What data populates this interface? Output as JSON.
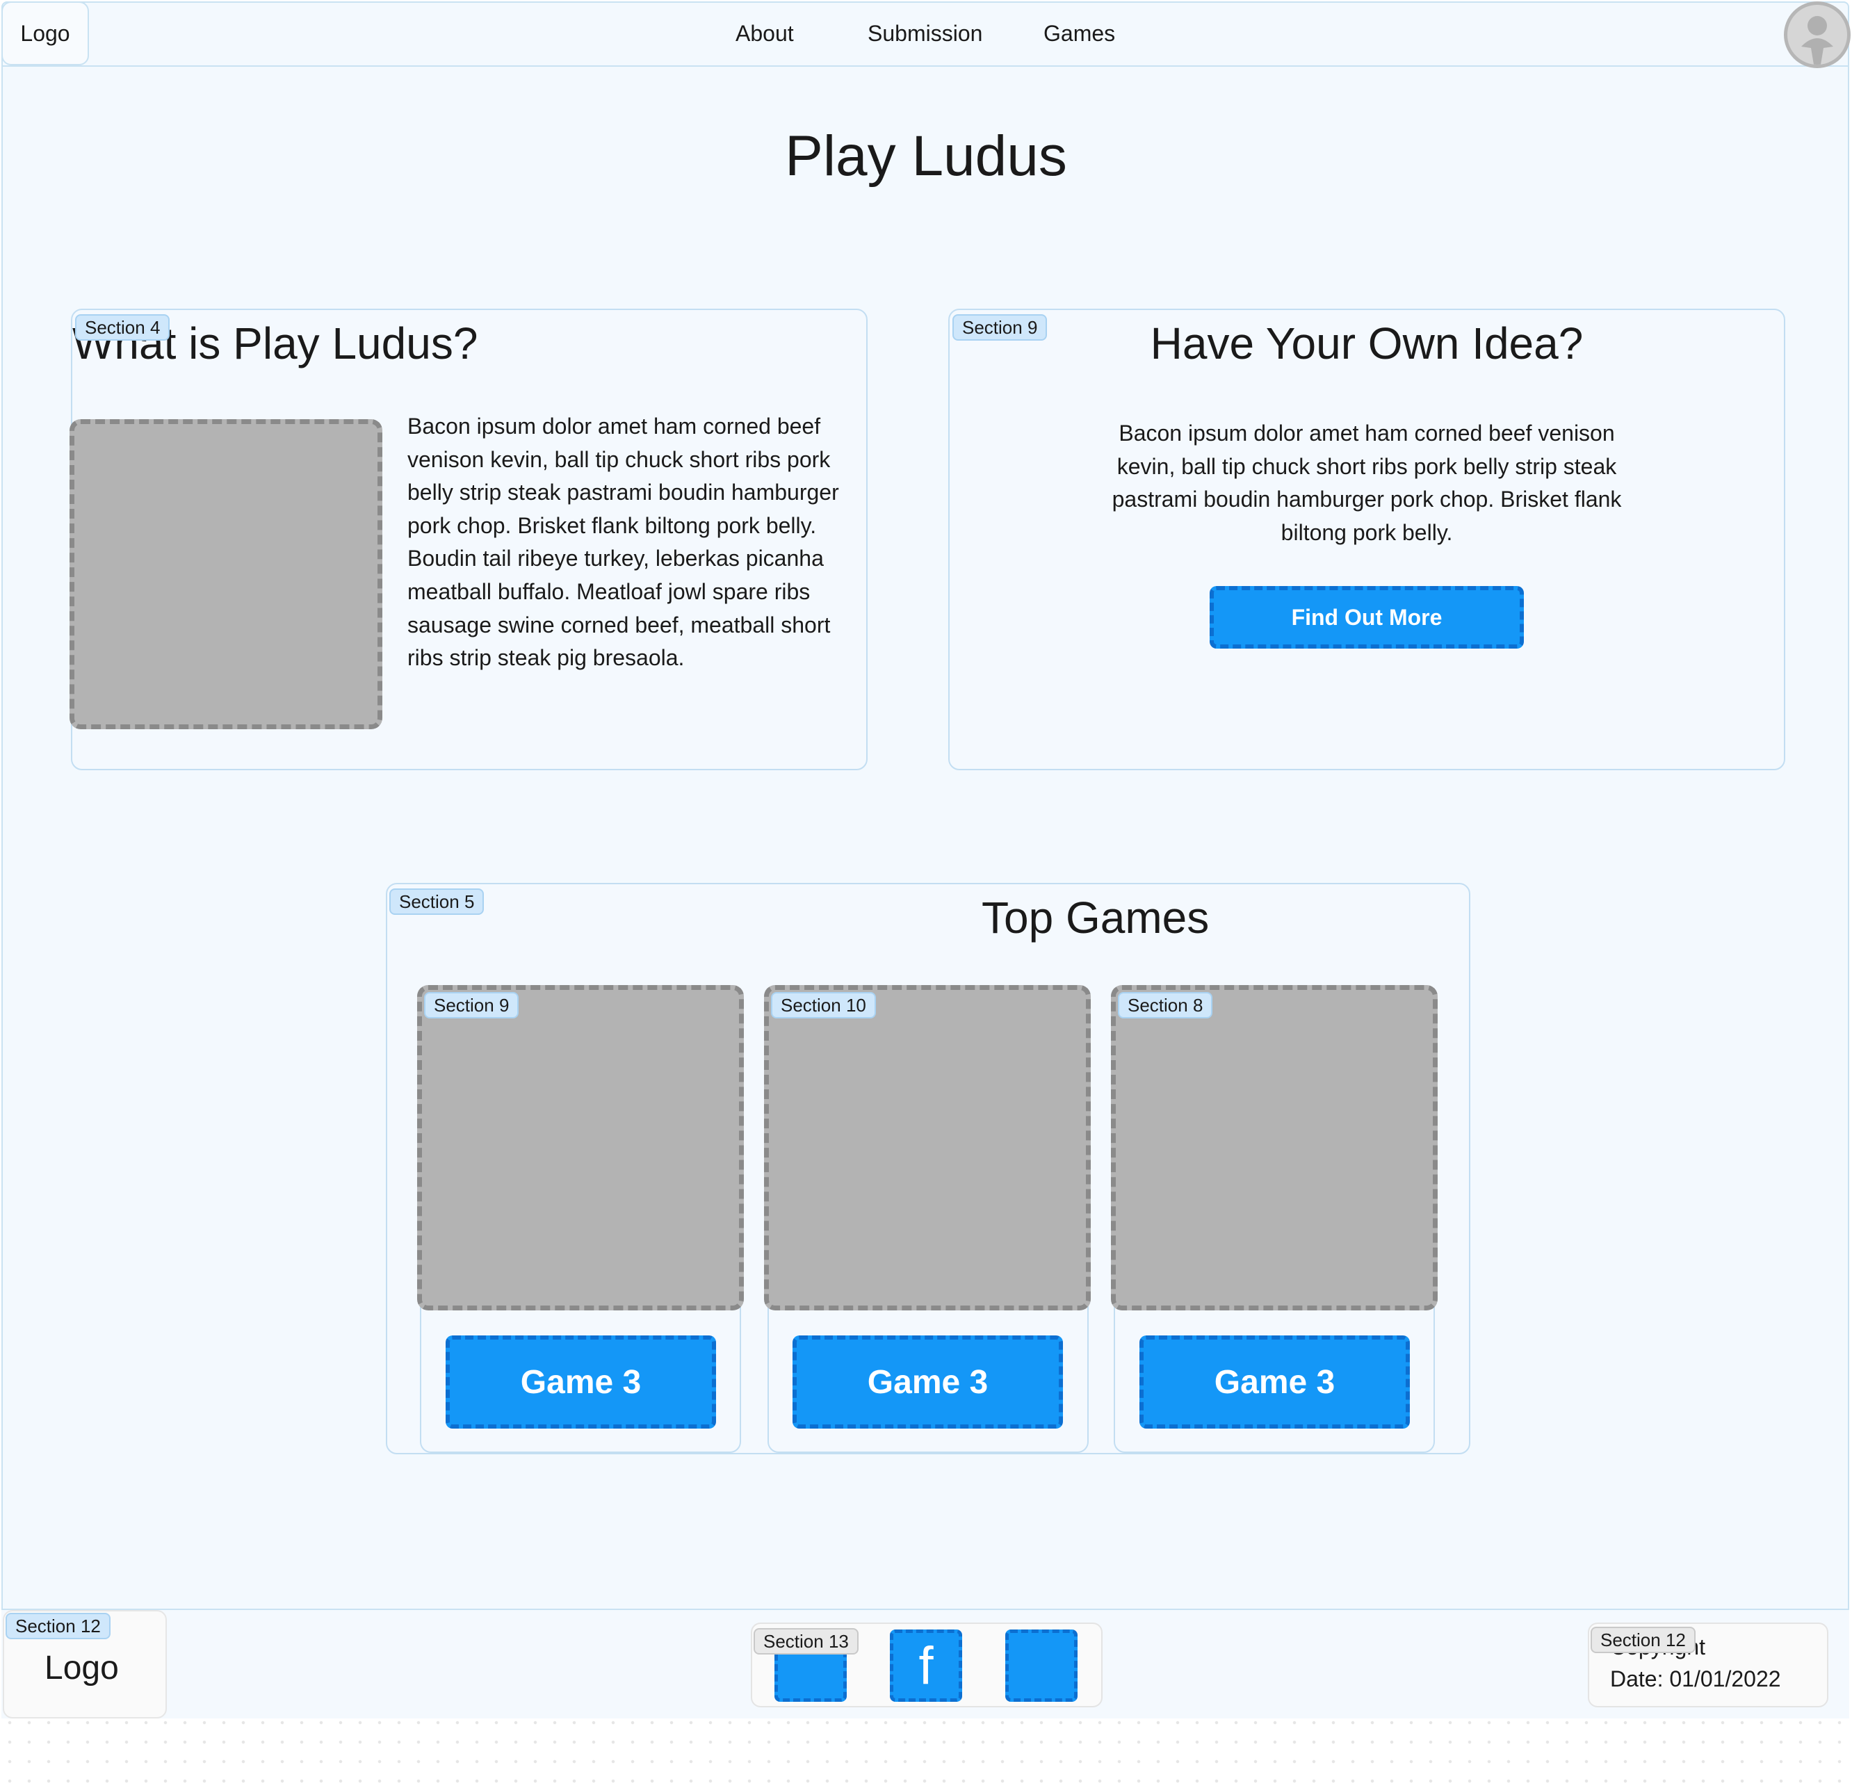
{
  "header": {
    "logo": "Logo",
    "nav": [
      "About",
      "Submission",
      "Games"
    ]
  },
  "page_title": "Play Ludus",
  "about_section": {
    "tag": "Section 4",
    "heading": "What is Play Ludus?",
    "body": "Bacon ipsum dolor amet ham corned beef venison kevin, ball tip chuck short ribs pork belly strip steak pastrami boudin hamburger pork chop. Brisket flank biltong pork belly. Boudin tail ribeye turkey, leberkas picanha meatball buffalo. Meatloaf jowl spare ribs sausage swine corned beef, meatball short ribs strip steak pig bresaola."
  },
  "idea_section": {
    "tag": "Section 9",
    "heading": "Have Your Own Idea?",
    "body": "Bacon ipsum dolor amet ham corned beef venison kevin, ball tip chuck short ribs pork belly strip steak pastrami boudin hamburger pork chop. Brisket flank biltong pork belly.",
    "button": "Find Out More"
  },
  "top_games": {
    "tag": "Section 5",
    "heading": "Top Games",
    "games": [
      {
        "tag": "Section 9",
        "button": "Game 3"
      },
      {
        "tag": "Section 10",
        "button": "Game 3"
      },
      {
        "tag": "Section 8",
        "button": "Game 3"
      }
    ]
  },
  "footer": {
    "logo_tag": "Section 12",
    "logo": "Logo",
    "social_tag": "Section 13",
    "social_icons": [
      "blank-icon",
      "facebook-icon",
      "blank-icon"
    ],
    "facebook_glyph": "f",
    "copyright_tag": "Section 12",
    "copyright": "Copyright",
    "date": "Date: 01/01/2022"
  },
  "colors": {
    "accent": "#1497f7",
    "accent_border": "#0c6fd1",
    "page_bg": "#f3f9fe",
    "placeholder": "#b3b3b3"
  }
}
